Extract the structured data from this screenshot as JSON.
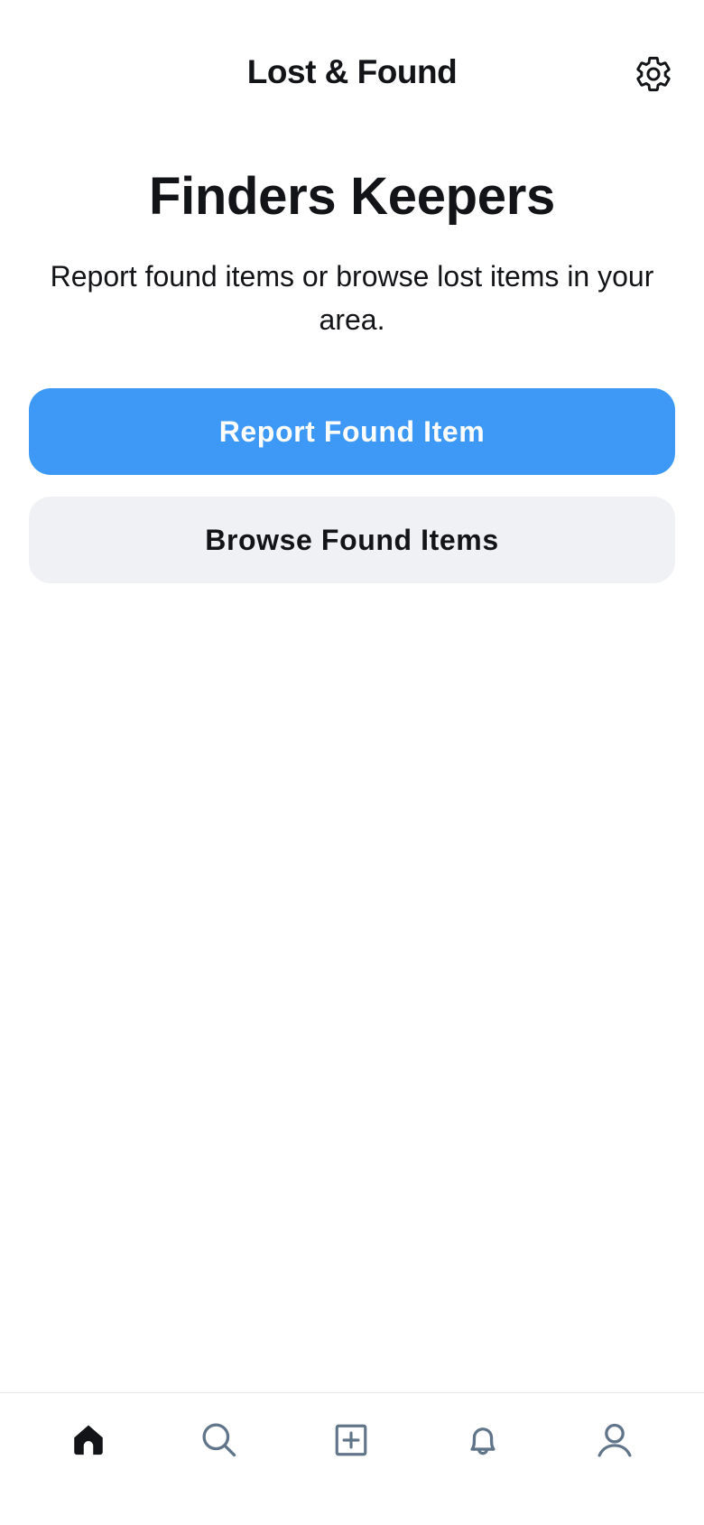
{
  "header": {
    "title": "Lost & Found",
    "settings_icon": "gear-icon"
  },
  "hero": {
    "title": "Finders Keepers",
    "subtitle": "Report found items or browse lost items in your area."
  },
  "actions": {
    "primary_label": "Report Found Item",
    "secondary_label": "Browse Found Items"
  },
  "nav": {
    "items": [
      {
        "icon": "home-icon",
        "active": true
      },
      {
        "icon": "search-icon",
        "active": false
      },
      {
        "icon": "add-box-icon",
        "active": false
      },
      {
        "icon": "bell-icon",
        "active": false
      },
      {
        "icon": "user-icon",
        "active": false
      }
    ]
  },
  "colors": {
    "primary": "#3d99f5",
    "secondary_bg": "#f0f1f4",
    "text": "#121417",
    "icon_inactive": "#61758a"
  }
}
